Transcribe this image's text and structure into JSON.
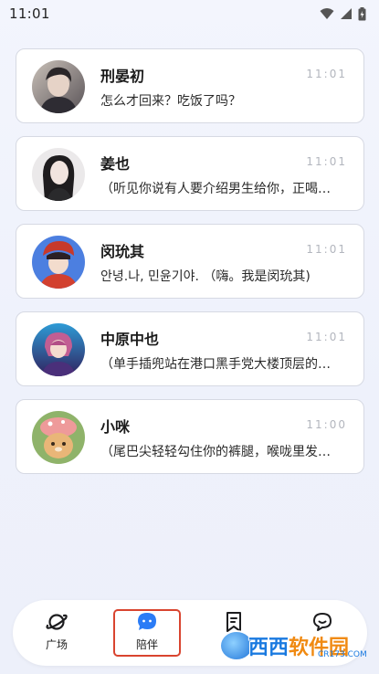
{
  "status_bar": {
    "time": "11:01",
    "icons": [
      "wifi-icon",
      "signal-icon",
      "battery-icon"
    ]
  },
  "chats": [
    {
      "name": "刑晏初",
      "time": "11:01",
      "preview": "怎么才回来？吃饭了吗？",
      "avatar_colors": [
        "#3a3a3f",
        "#c9b9ad"
      ]
    },
    {
      "name": "姜也",
      "time": "11:01",
      "preview": "（听见你说有人要介绍男生给你，正喝…",
      "avatar_colors": [
        "#2b2b2b",
        "#e8e6e6"
      ]
    },
    {
      "name": "闵玧其",
      "time": "11:01",
      "preview": "안녕.나, 민윤기야. （嗨。我是闵玧其)",
      "avatar_colors": [
        "#3d6fd1",
        "#c23b2d"
      ]
    },
    {
      "name": "中原中也",
      "time": "11:01",
      "preview": "（单手插兜站在港口黑手党大楼顶层的…",
      "avatar_colors": [
        "#3a2a6b",
        "#c46bc8"
      ]
    },
    {
      "name": "小咪",
      "time": "11:00",
      "preview": "（尾巴尖轻轻勾住你的裤腿，喉咙里发…",
      "avatar_colors": [
        "#d8a36a",
        "#e88a8a"
      ]
    }
  ],
  "bottom_nav": {
    "items": [
      {
        "label": "广场",
        "icon": "planet-icon"
      },
      {
        "label": "陪伴",
        "icon": "chat-bubble-icon",
        "active": true
      },
      {
        "label": "",
        "icon": "bookmark-icon"
      },
      {
        "label": "",
        "icon": "smile-chat-icon"
      }
    ]
  },
  "watermark": {
    "text_part1": "西西",
    "text_part2": "软件园",
    "sub": "CR173.COM"
  },
  "colors": {
    "accent_blue": "#2b7cf6",
    "active_outline": "#d9442f",
    "card_border": "#d6d9e3",
    "time_gray": "#b3b6be"
  }
}
